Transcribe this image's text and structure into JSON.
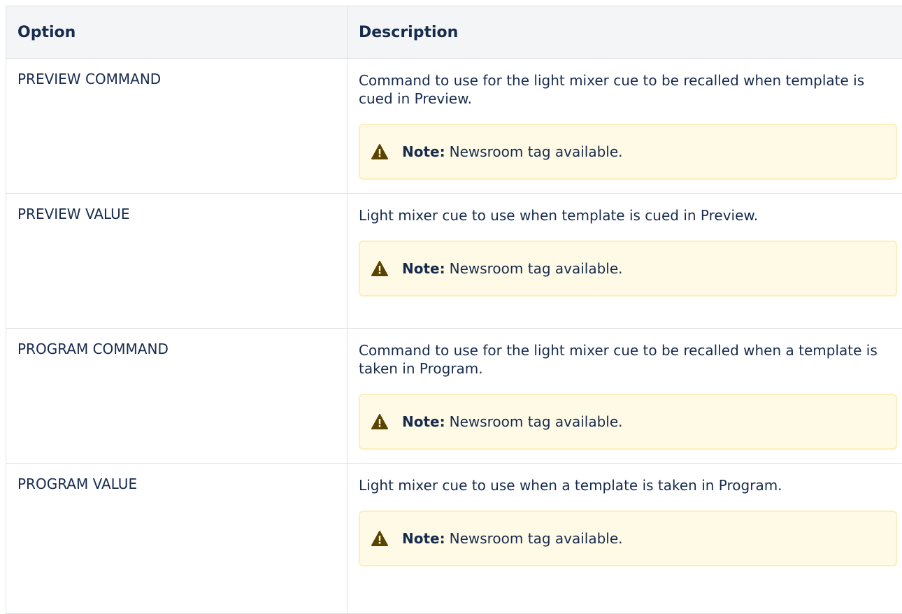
{
  "table": {
    "headers": {
      "option": "Option",
      "description": "Description"
    },
    "rows": [
      {
        "option": "PREVIEW COMMAND",
        "description": "Command to use for the light mixer cue to be recalled when template is cued in Preview.",
        "note_label": "Note:",
        "note_text": "Newsroom tag available."
      },
      {
        "option": "PREVIEW VALUE",
        "description": "Light mixer cue to use when template is cued in Preview.",
        "note_label": "Note:",
        "note_text": "Newsroom tag available."
      },
      {
        "option": "PROGRAM COMMAND",
        "description": "Command to use for the light mixer cue to be recalled when a template is taken in Program.",
        "note_label": "Note:",
        "note_text": "Newsroom tag available."
      },
      {
        "option": "PROGRAM VALUE",
        "description": "Light mixer cue to use when a template is taken in Program.",
        "note_label": "Note:",
        "note_text": "Newsroom tag available."
      }
    ]
  },
  "colors": {
    "header_bg": "#f4f5f7",
    "border": "#dfe1e6",
    "note_bg": "#fffae6",
    "note_border": "#ffeebb",
    "warning_icon": "#5b4300"
  },
  "icons": {
    "note": "warning-icon"
  }
}
